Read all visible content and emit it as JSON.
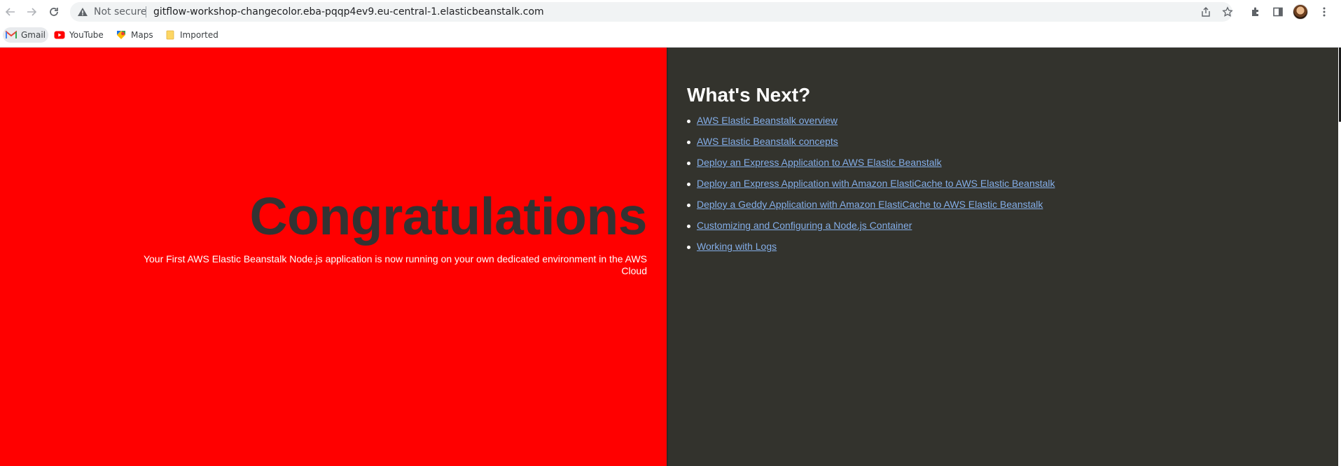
{
  "browser": {
    "security_label": "Not secure",
    "url": "gitflow-workshop-changecolor.eba-pqqp4ev9.eu-central-1.elasticbeanstalk.com",
    "icons": [
      "back-icon",
      "forward-icon",
      "reload-icon",
      "warning-icon",
      "share-icon",
      "star-icon",
      "extensions-icon",
      "side-panel-icon",
      "avatar",
      "menu-icon"
    ]
  },
  "bookmarks": [
    {
      "label": "Gmail",
      "icon": "gmail-icon"
    },
    {
      "label": "YouTube",
      "icon": "youtube-icon"
    },
    {
      "label": "Maps",
      "icon": "maps-icon"
    },
    {
      "label": "Imported",
      "icon": "folder-icon"
    }
  ],
  "page": {
    "left": {
      "heading": "Congratulations",
      "message": "Your First AWS Elastic Beanstalk Node.js application is now running on your own dedicated environment in the AWS Cloud"
    },
    "right": {
      "heading": "What's Next?",
      "links": [
        "AWS Elastic Beanstalk overview",
        "AWS Elastic Beanstalk concepts",
        "Deploy an Express Application to AWS Elastic Beanstalk",
        "Deploy an Express Application with Amazon ElastiCache to AWS Elastic Beanstalk",
        "Deploy a Geddy Application with Amazon ElastiCache to AWS Elastic Beanstalk",
        "Customizing and Configuring a Node.js Container",
        "Working with Logs"
      ]
    }
  },
  "colors": {
    "left_bg": "#ff0000",
    "right_bg": "#33332d",
    "heading_text": "#333333",
    "link": "#84aee8"
  }
}
